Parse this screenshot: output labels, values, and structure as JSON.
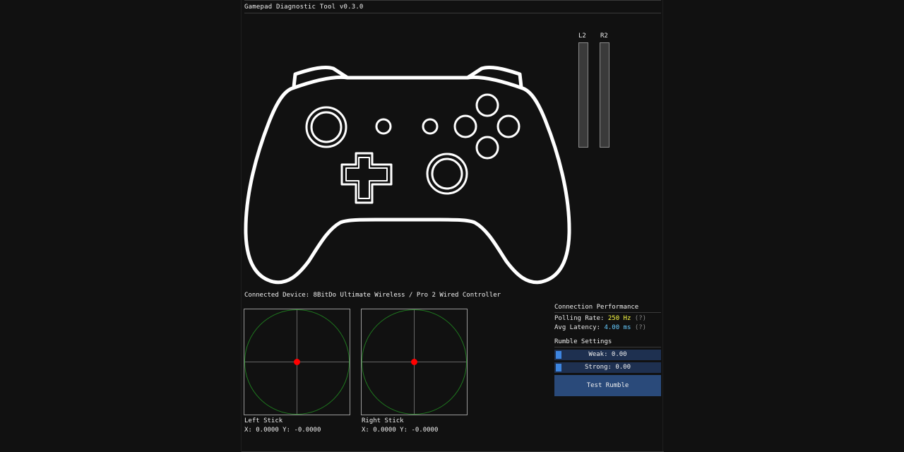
{
  "window": {
    "title": "Gamepad Diagnostic Tool v0.3.0"
  },
  "triggers": {
    "l2": {
      "label": "L2",
      "value": 0.0
    },
    "r2": {
      "label": "R2",
      "value": 0.0
    }
  },
  "device": {
    "text": "Connected Device: 8BitDo Ultimate Wireless / Pro 2 Wired Controller"
  },
  "sticks": {
    "left": {
      "label": "Left Stick",
      "readout": "X: 0.0000 Y: -0.0000",
      "x": 0.0,
      "y": 0.0
    },
    "right": {
      "label": "Right Stick",
      "readout": "X: 0.0000 Y: -0.0000",
      "x": 0.0,
      "y": 0.0
    }
  },
  "connection": {
    "title": "Connection Performance",
    "polling_label": "Polling Rate: ",
    "polling_value": "250 Hz",
    "latency_label": "Avg Latency: ",
    "latency_value": "4.00 ms",
    "help": "(?)"
  },
  "rumble": {
    "title": "Rumble Settings",
    "weak": {
      "label": "Weak: 0.00",
      "value": 0.0
    },
    "strong": {
      "label": "Strong: 0.00",
      "value": 0.0
    },
    "test_button": "Test Rumble"
  },
  "colors": {
    "background": "#111111",
    "stick_circle": "#1f7a1f",
    "stick_dot": "#ff0000",
    "slider_bg": "#1e3050",
    "slider_grab": "#3d85e0",
    "button": "#2a4a7a",
    "polling_value": "#ffff44",
    "latency_value": "#66ccff"
  }
}
